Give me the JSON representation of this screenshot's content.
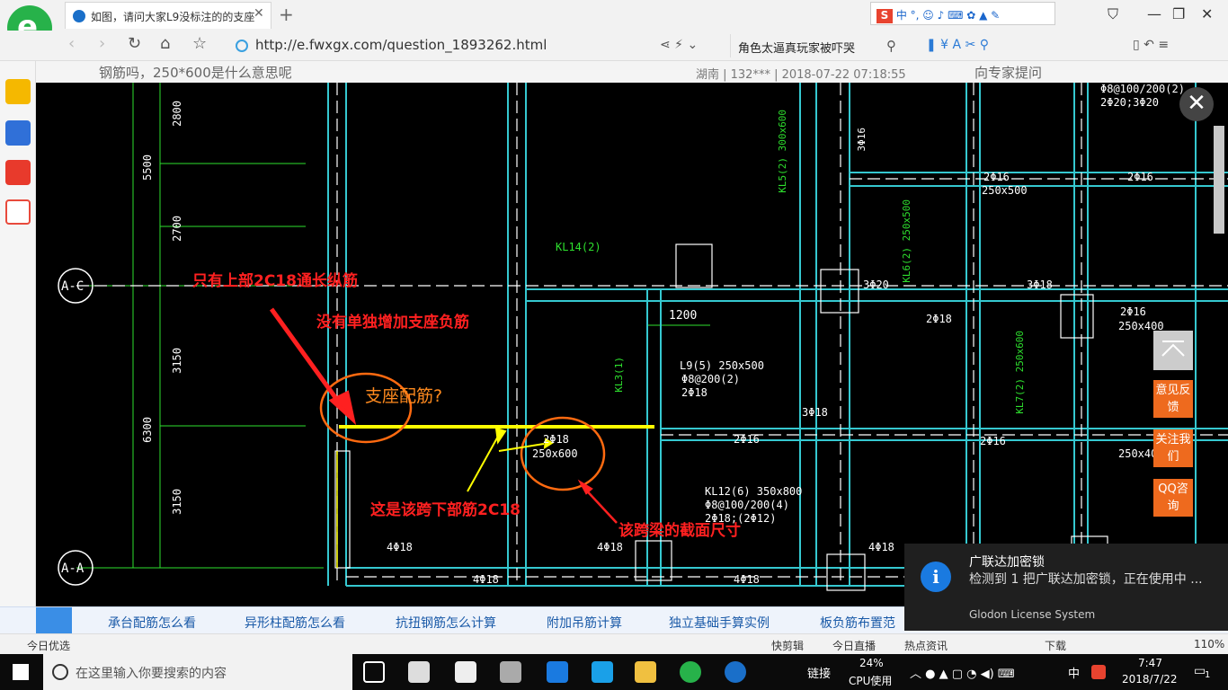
{
  "browser": {
    "tab_title": "如图，请问大家L9没标注的的支座",
    "url": "http://e.fwxgx.com/question_1893262.html",
    "search_text": "角色太逼真玩家被吓哭",
    "ime_label": "中 °,",
    "zoom": "110%"
  },
  "question_strip": {
    "meta": "湖南 | 132*** | 2018-07-22 07:18:55",
    "ask_button": "向专家提问",
    "question_text": "钢筋吗，250*600是什么意思呢"
  },
  "cad": {
    "red_annotations": [
      "只有上部2C18通长纵筋",
      "没有单独增加支座负筋",
      "支座配筋?",
      "这是该跨下部筋2C18",
      "该跨梁的截面尺寸"
    ],
    "axis_labels": [
      "A-C",
      "A-A"
    ],
    "dims": [
      "2800",
      "5500",
      "2700",
      "3150",
      "6300",
      "3150",
      "1200"
    ],
    "white_texts": [
      "2Φ18",
      "250x600",
      "L9(5) 250x500",
      "Φ8@200(2)",
      "2Φ18",
      "3Φ18",
      "2Φ16",
      "4Φ18",
      "4Φ18",
      "4Φ18",
      "4Φ18",
      "4Φ18",
      "3Φ20",
      "3Φ18",
      "2Φ16",
      "250x400",
      "2Φ16",
      "3Φ16",
      "2Φ16",
      "250x500",
      "Φ8@100/200(2)",
      "2Φ20;3Φ20",
      "KL12(6) 350x800",
      "Φ8@100/200(4)",
      "2Φ18;(2Φ12)",
      "2Φ16",
      "250x40",
      "2Φ18"
    ],
    "green_texts": [
      "KL14(2)",
      "KL3(1)",
      "KL5(2) 300x600",
      "KL6(2) 250x500",
      "KL7(2) 250x600"
    ]
  },
  "float_buttons": [
    "意见反馈",
    "关注我们",
    "QQ咨询"
  ],
  "bottom_links": [
    "承台配筋怎么看",
    "异形柱配筋怎么看",
    "抗扭钢筋怎么计算",
    "附加吊筋计算",
    "独立基础手算实例",
    "板负筋布置范"
  ],
  "status_bar": {
    "left": "今日优选",
    "items": [
      "快剪辑",
      "今日直播",
      "热点资讯",
      "下载"
    ],
    "zoom": "110%"
  },
  "notification": {
    "title": "广联达加密锁",
    "body": "检测到 1 把广联达加密锁，正在使用中 ...",
    "source": "Glodon License System"
  },
  "taskbar": {
    "search_placeholder": "在这里输入你要搜索的内容",
    "link_label": "链接",
    "cpu_percent": "24%",
    "cpu_label": "CPU使用",
    "ime": "中",
    "time": "7:47",
    "date": "2018/7/22",
    "notif_count": "1"
  },
  "colors": {
    "cad_bg": "#000000",
    "cad_line": "#35c8d0",
    "cad_green": "#2ee02e",
    "annotation_red": "#ff2020",
    "yellow": "#ffff00",
    "orange_btn": "#ee6a1e"
  }
}
